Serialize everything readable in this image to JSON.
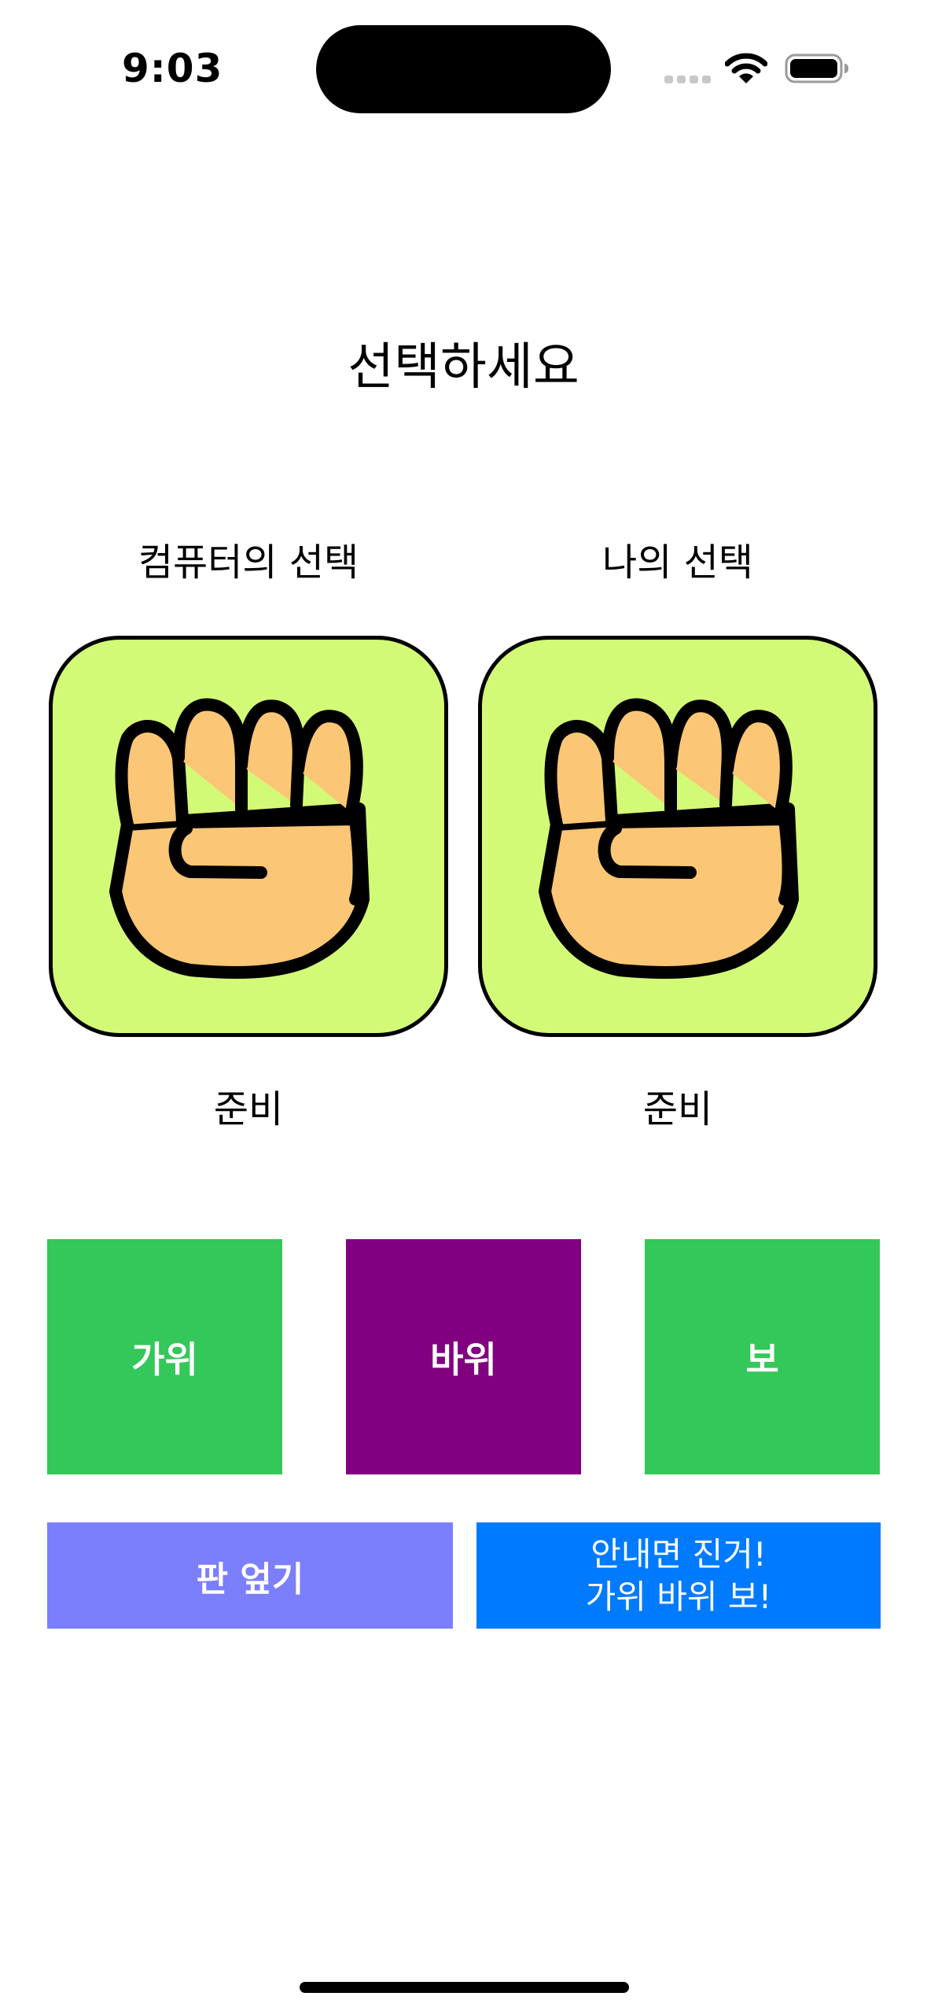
{
  "status_bar": {
    "time": "9:03",
    "icons": [
      "cellular-signal-icon",
      "wifi-icon",
      "battery-icon"
    ]
  },
  "title": "선택하세요",
  "computer": {
    "label": "컴퓨터의 선택",
    "image_icon": "rock-fist-icon",
    "status": "준비"
  },
  "player": {
    "label": "나의 선택",
    "image_icon": "rock-fist-icon",
    "status": "준비"
  },
  "choices": {
    "scissors": "가위",
    "rock": "바위",
    "paper": "보"
  },
  "actions": {
    "reset": "판 엎기",
    "play_line1": "안내면 진거!",
    "play_line2": "가위 바위 보!"
  },
  "colors": {
    "card_background": "#d3fa77",
    "hand_skin": "#fbc675",
    "choice_green": "#34c759",
    "choice_purple": "#800080",
    "reset_button": "#7b7ffc",
    "play_button": "#007aff"
  }
}
